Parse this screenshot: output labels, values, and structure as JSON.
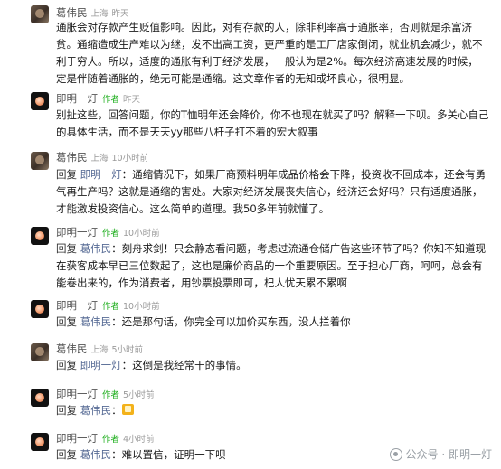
{
  "tags": {
    "author": "作者"
  },
  "reply_prefix": "回复",
  "watermark": {
    "icon": "wechat-official-account-icon",
    "text": "公众号 · 即明一灯"
  },
  "comments": [
    {
      "avatar": "user-avatar-wei",
      "name": "葛伟民",
      "location": "上海",
      "time": "昨天",
      "is_author": false,
      "reply_to": "",
      "text": "通胀会对存款产生贬值影响。因此，对有存款的人，除非利率高于通胀率，否则就是杀富济贫。通缩造成生产难以为继，发不出高工资，更严重的是工厂店家倒闭，就业机会减少，就不利于穷人。所以，适度的通胀有利于经济发展，一般认为是2%。每次经济高速发展的时候，一定是伴随着通胀的，绝无可能是通缩。这文章作者的无知或坏良心，很明显。"
    },
    {
      "avatar": "author-avatar-ming",
      "name": "即明一灯",
      "location": "",
      "time": "昨天",
      "is_author": true,
      "reply_to": "",
      "text": "别扯这些，回答问题，你的T恤明年还会降价，你不也现在就买了吗？解释一下呗。多关心自己的具体生活，而不是天天yy那些八杆子打不着的宏大叙事"
    },
    {
      "avatar": "user-avatar-wei",
      "name": "葛伟民",
      "location": "上海",
      "time": "10小时前",
      "is_author": false,
      "reply_to": "即明一灯",
      "text": "通缩情况下，如果厂商预料明年成品价格会下降，投资收不回成本，还会有勇气再生产吗？这就是通缩的害处。大家对经济发展丧失信心，经济还会好吗？只有适度通胀，才能激发投资信心。这么简单的道理。我50多年前就懂了。"
    },
    {
      "avatar": "author-avatar-ming",
      "name": "即明一灯",
      "location": "",
      "time": "10小时前",
      "is_author": true,
      "reply_to": "葛伟民",
      "text": "刻舟求剑！只会静态看问题，考虑过流通仓储广告这些环节了吗？你知不知道现在获客成本早已三位数起了，这也是廉价商品的一个重要原因。至于担心厂商，呵呵，总会有能卷出来的，作为消费者，用钞票投票即可，杞人忧天累不累啊"
    },
    {
      "avatar": "author-avatar-ming",
      "name": "即明一灯",
      "location": "",
      "time": "10小时前",
      "is_author": true,
      "reply_to": "葛伟民",
      "text": "还是那句话，你完全可以加价买东西，没人拦着你"
    },
    {
      "avatar": "user-avatar-wei",
      "name": "葛伟民",
      "location": "上海",
      "time": "5小时前",
      "is_author": false,
      "reply_to": "即明一灯",
      "text": "这倒是我经常干的事情。"
    },
    {
      "avatar": "author-avatar-ming",
      "name": "即明一灯",
      "location": "",
      "time": "5小时前",
      "is_author": true,
      "reply_to": "葛伟民",
      "text": "",
      "emoji": "thumbs-up-emoji-icon"
    },
    {
      "avatar": "author-avatar-ming",
      "name": "即明一灯",
      "location": "",
      "time": "4小时前",
      "is_author": true,
      "reply_to": "葛伟民",
      "text": "难以置信，证明一下呗"
    }
  ]
}
